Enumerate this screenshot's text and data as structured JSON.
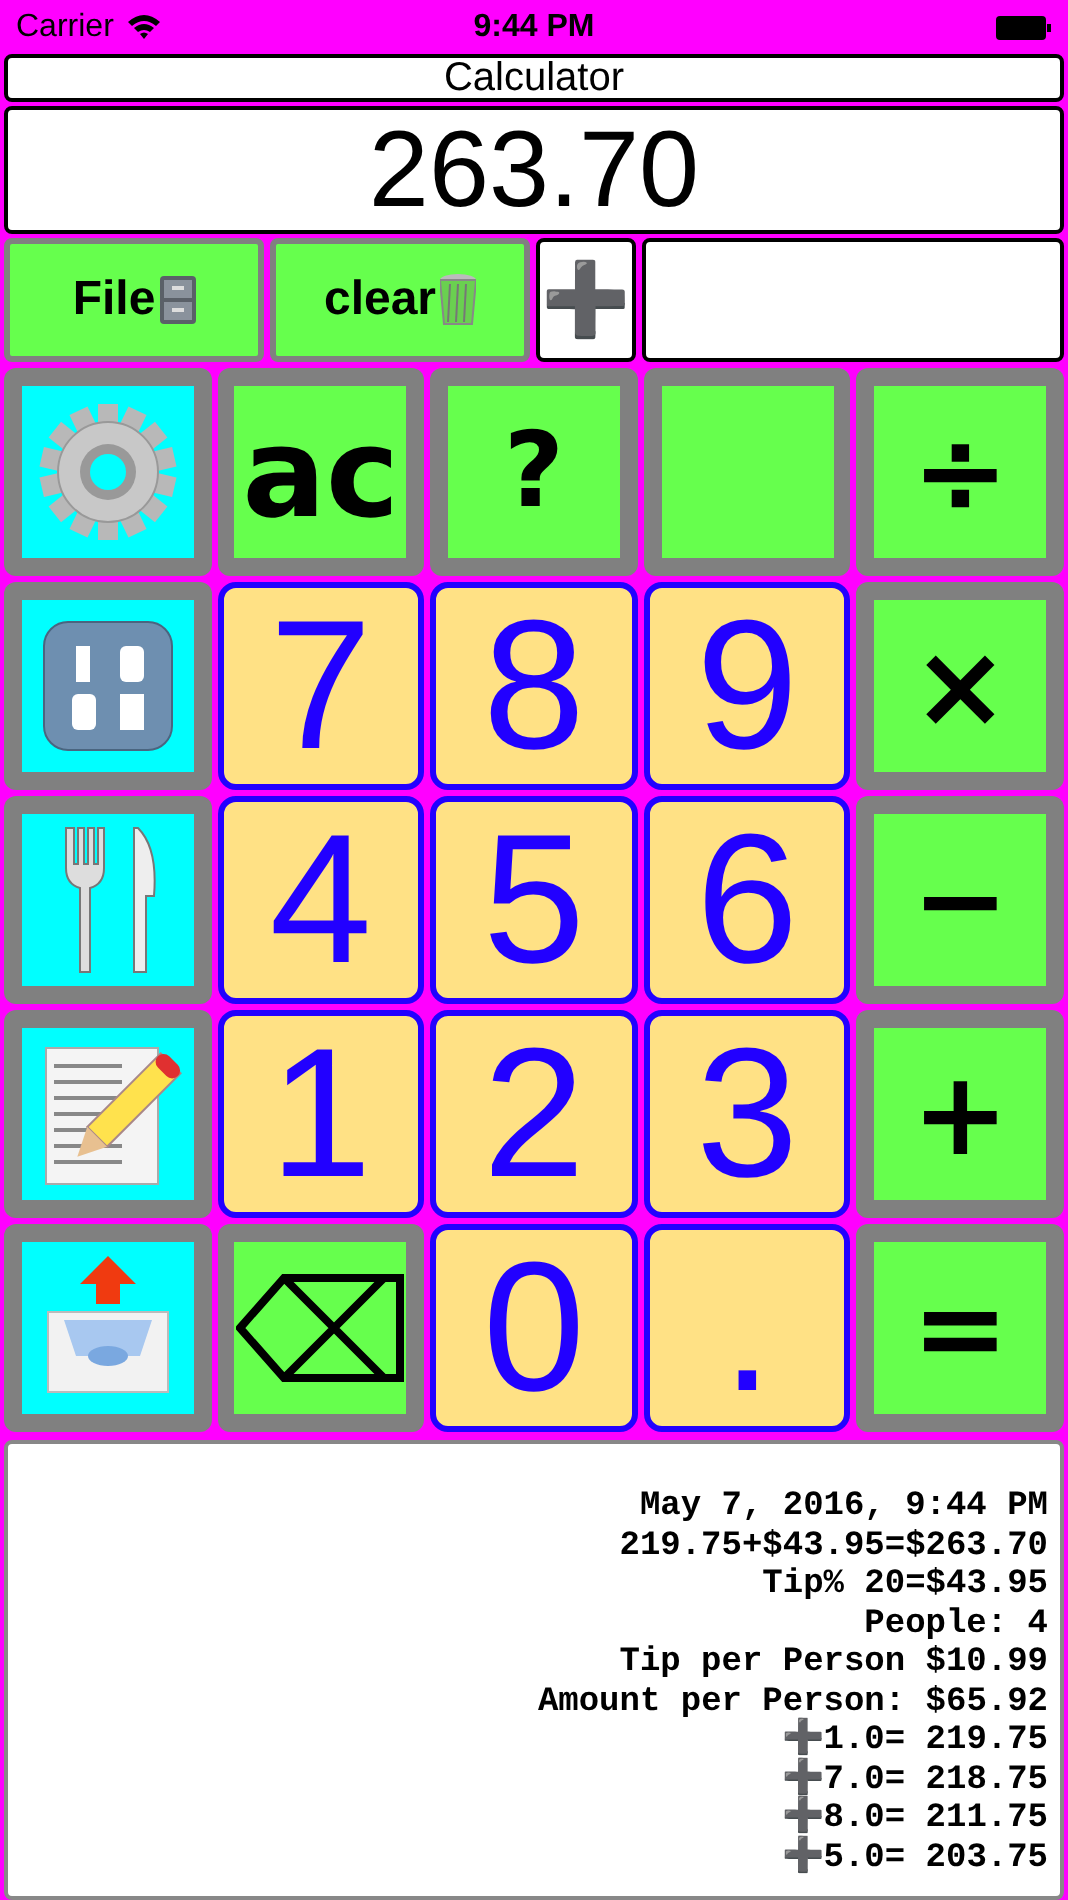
{
  "status_bar": {
    "carrier": "Carrier",
    "time": "9:44 PM"
  },
  "title": "Calculator",
  "display": "263.70",
  "toolbar": {
    "file_label": "File",
    "clear_label": "clear",
    "add_symbol": "➕"
  },
  "keys": [
    [
      {
        "kind": "icon"
      },
      {
        "kind": "function",
        "label": "ac"
      },
      {
        "kind": "function",
        "label": "?"
      },
      {
        "kind": "blank"
      },
      {
        "kind": "operator",
        "label": "÷"
      }
    ],
    [
      {
        "kind": "icon"
      },
      {
        "kind": "digit",
        "label": "7"
      },
      {
        "kind": "digit",
        "label": "8"
      },
      {
        "kind": "digit",
        "label": "9"
      },
      {
        "kind": "operator",
        "label": "×"
      }
    ],
    [
      {
        "kind": "icon"
      },
      {
        "kind": "digit",
        "label": "4"
      },
      {
        "kind": "digit",
        "label": "5"
      },
      {
        "kind": "digit",
        "label": "6"
      },
      {
        "kind": "operator",
        "label": "−"
      }
    ],
    [
      {
        "kind": "icon"
      },
      {
        "kind": "digit",
        "label": "1"
      },
      {
        "kind": "digit",
        "label": "2"
      },
      {
        "kind": "digit",
        "label": "3"
      },
      {
        "kind": "operator",
        "label": "+"
      }
    ],
    [
      {
        "kind": "icon"
      },
      {
        "kind": "backspace"
      },
      {
        "kind": "digit",
        "label": "0"
      },
      {
        "kind": "digit",
        "label": "."
      },
      {
        "kind": "operator",
        "label": "="
      }
    ]
  ],
  "tape": [
    "May 7, 2016, 9:44 PM",
    "219.75+$43.95=$263.70",
    "Tip% 20=$43.95",
    "People: 4",
    "Tip per Person $10.99",
    "Amount per Person: $65.92",
    "➕1.0= 219.75",
    "➕7.0= 218.75",
    "➕8.0= 211.75",
    "➕5.0= 203.75"
  ]
}
